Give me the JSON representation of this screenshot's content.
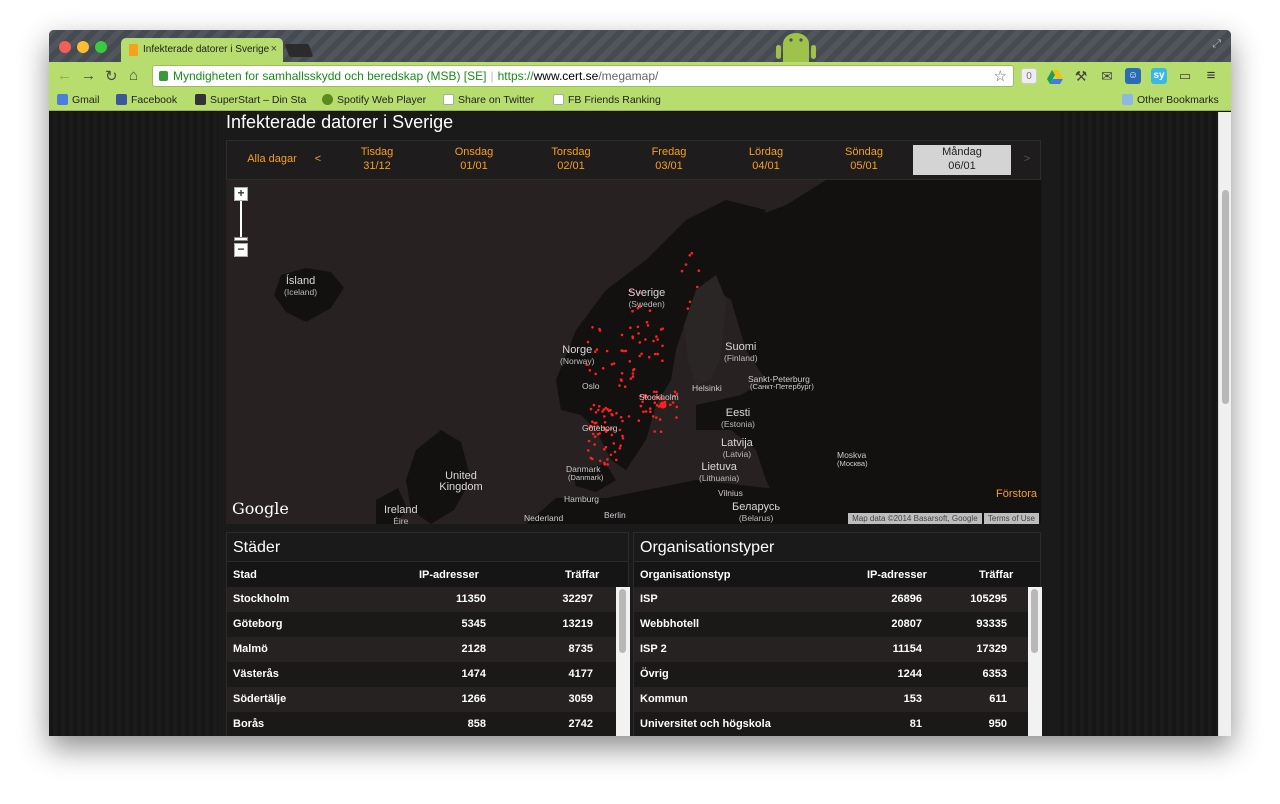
{
  "browser": {
    "tab_title": "Infekterade datorer i Sverige",
    "tab_close": "×",
    "address": {
      "ev_name": "Myndigheten for samhallsskydd och beredskap (MSB) [SE]",
      "scheme": "https://",
      "host": "www.cert.se",
      "path": "/megamap/"
    },
    "extension_badge": "0",
    "bookmarks": [
      {
        "label": "Gmail",
        "icon": "google-icon",
        "color": "#4a7fe0"
      },
      {
        "label": "Facebook",
        "icon": "facebook-icon",
        "color": "#3b5998"
      },
      {
        "label": "SuperStart – Din Sta",
        "icon": "superstart-icon",
        "color": "#333333"
      },
      {
        "label": "Spotify Web Player",
        "icon": "spotify-icon",
        "color": "#5b8a1f"
      },
      {
        "label": "Share on Twitter",
        "icon": "page-icon",
        "color": "#ffffff"
      },
      {
        "label": "FB Friends Ranking",
        "icon": "page-icon",
        "color": "#ffffff"
      }
    ],
    "other_bookmarks": "Other Bookmarks"
  },
  "page": {
    "title": "Infekterade datorer i Sverige",
    "days": {
      "all_label": "Alla dagar",
      "prev": "<",
      "next": ">",
      "items": [
        {
          "day": "Tisdag",
          "date": "31/12"
        },
        {
          "day": "Onsdag",
          "date": "01/01"
        },
        {
          "day": "Torsdag",
          "date": "02/01"
        },
        {
          "day": "Fredag",
          "date": "03/01"
        },
        {
          "day": "Lördag",
          "date": "04/01"
        },
        {
          "day": "Söndag",
          "date": "05/01"
        },
        {
          "day": "Måndag",
          "date": "06/01"
        }
      ],
      "active_index": 6
    },
    "map": {
      "zoom_in": "+",
      "zoom_out": "−",
      "countries": [
        {
          "name": "Ísland",
          "sub": "(Iceland)"
        },
        {
          "name": "Sverige",
          "sub": "(Sweden)"
        },
        {
          "name": "Norge",
          "sub": "(Norway)"
        },
        {
          "name": "Suomi",
          "sub": "(Finland)"
        },
        {
          "name": "Eesti",
          "sub": "(Estonia)"
        },
        {
          "name": "Latvija",
          "sub": "(Latvia)"
        },
        {
          "name": "Lietuva",
          "sub": "(Lithuania)"
        },
        {
          "name": "United Kingdom",
          "sub": ""
        },
        {
          "name": "Ireland",
          "sub": "Éire"
        },
        {
          "name": "Беларусь",
          "sub": "(Belarus)"
        }
      ],
      "cities": [
        "Oslo",
        "Stockholm",
        "Helsinki",
        "Sankt-Peterburg",
        "(Санкт-Петербург)",
        "Göteborg",
        "Danmark",
        "(Danmark)",
        "Moskva",
        "(Москва)",
        "Hamburg",
        "Berlin",
        "Nederland",
        "Vilnius"
      ],
      "google": "Google",
      "attribution": "Map data ©2014 Basarsoft, Google",
      "terms": "Terms of Use",
      "enlarge": "Förstora",
      "dot_color": "#ff2020"
    },
    "cities_table": {
      "title": "Städer",
      "headers": [
        "Stad",
        "IP-adresser",
        "Träffar"
      ],
      "rows": [
        [
          "Stockholm",
          "11350",
          "32297"
        ],
        [
          "Göteborg",
          "5345",
          "13219"
        ],
        [
          "Malmö",
          "2128",
          "8735"
        ],
        [
          "Västerås",
          "1474",
          "4177"
        ],
        [
          "Södertälje",
          "1266",
          "3059"
        ],
        [
          "Borås",
          "858",
          "2742"
        ]
      ]
    },
    "org_table": {
      "title": "Organisationstyper",
      "headers": [
        "Organisationstyp",
        "IP-adresser",
        "Träffar"
      ],
      "rows": [
        [
          "ISP",
          "26896",
          "105295"
        ],
        [
          "Webbhotell",
          "20807",
          "93335"
        ],
        [
          "ISP 2",
          "11154",
          "17329"
        ],
        [
          "Övrig",
          "1244",
          "6353"
        ],
        [
          "Kommun",
          "153",
          "611"
        ],
        [
          "Universitet och högskola",
          "81",
          "950"
        ]
      ]
    }
  }
}
